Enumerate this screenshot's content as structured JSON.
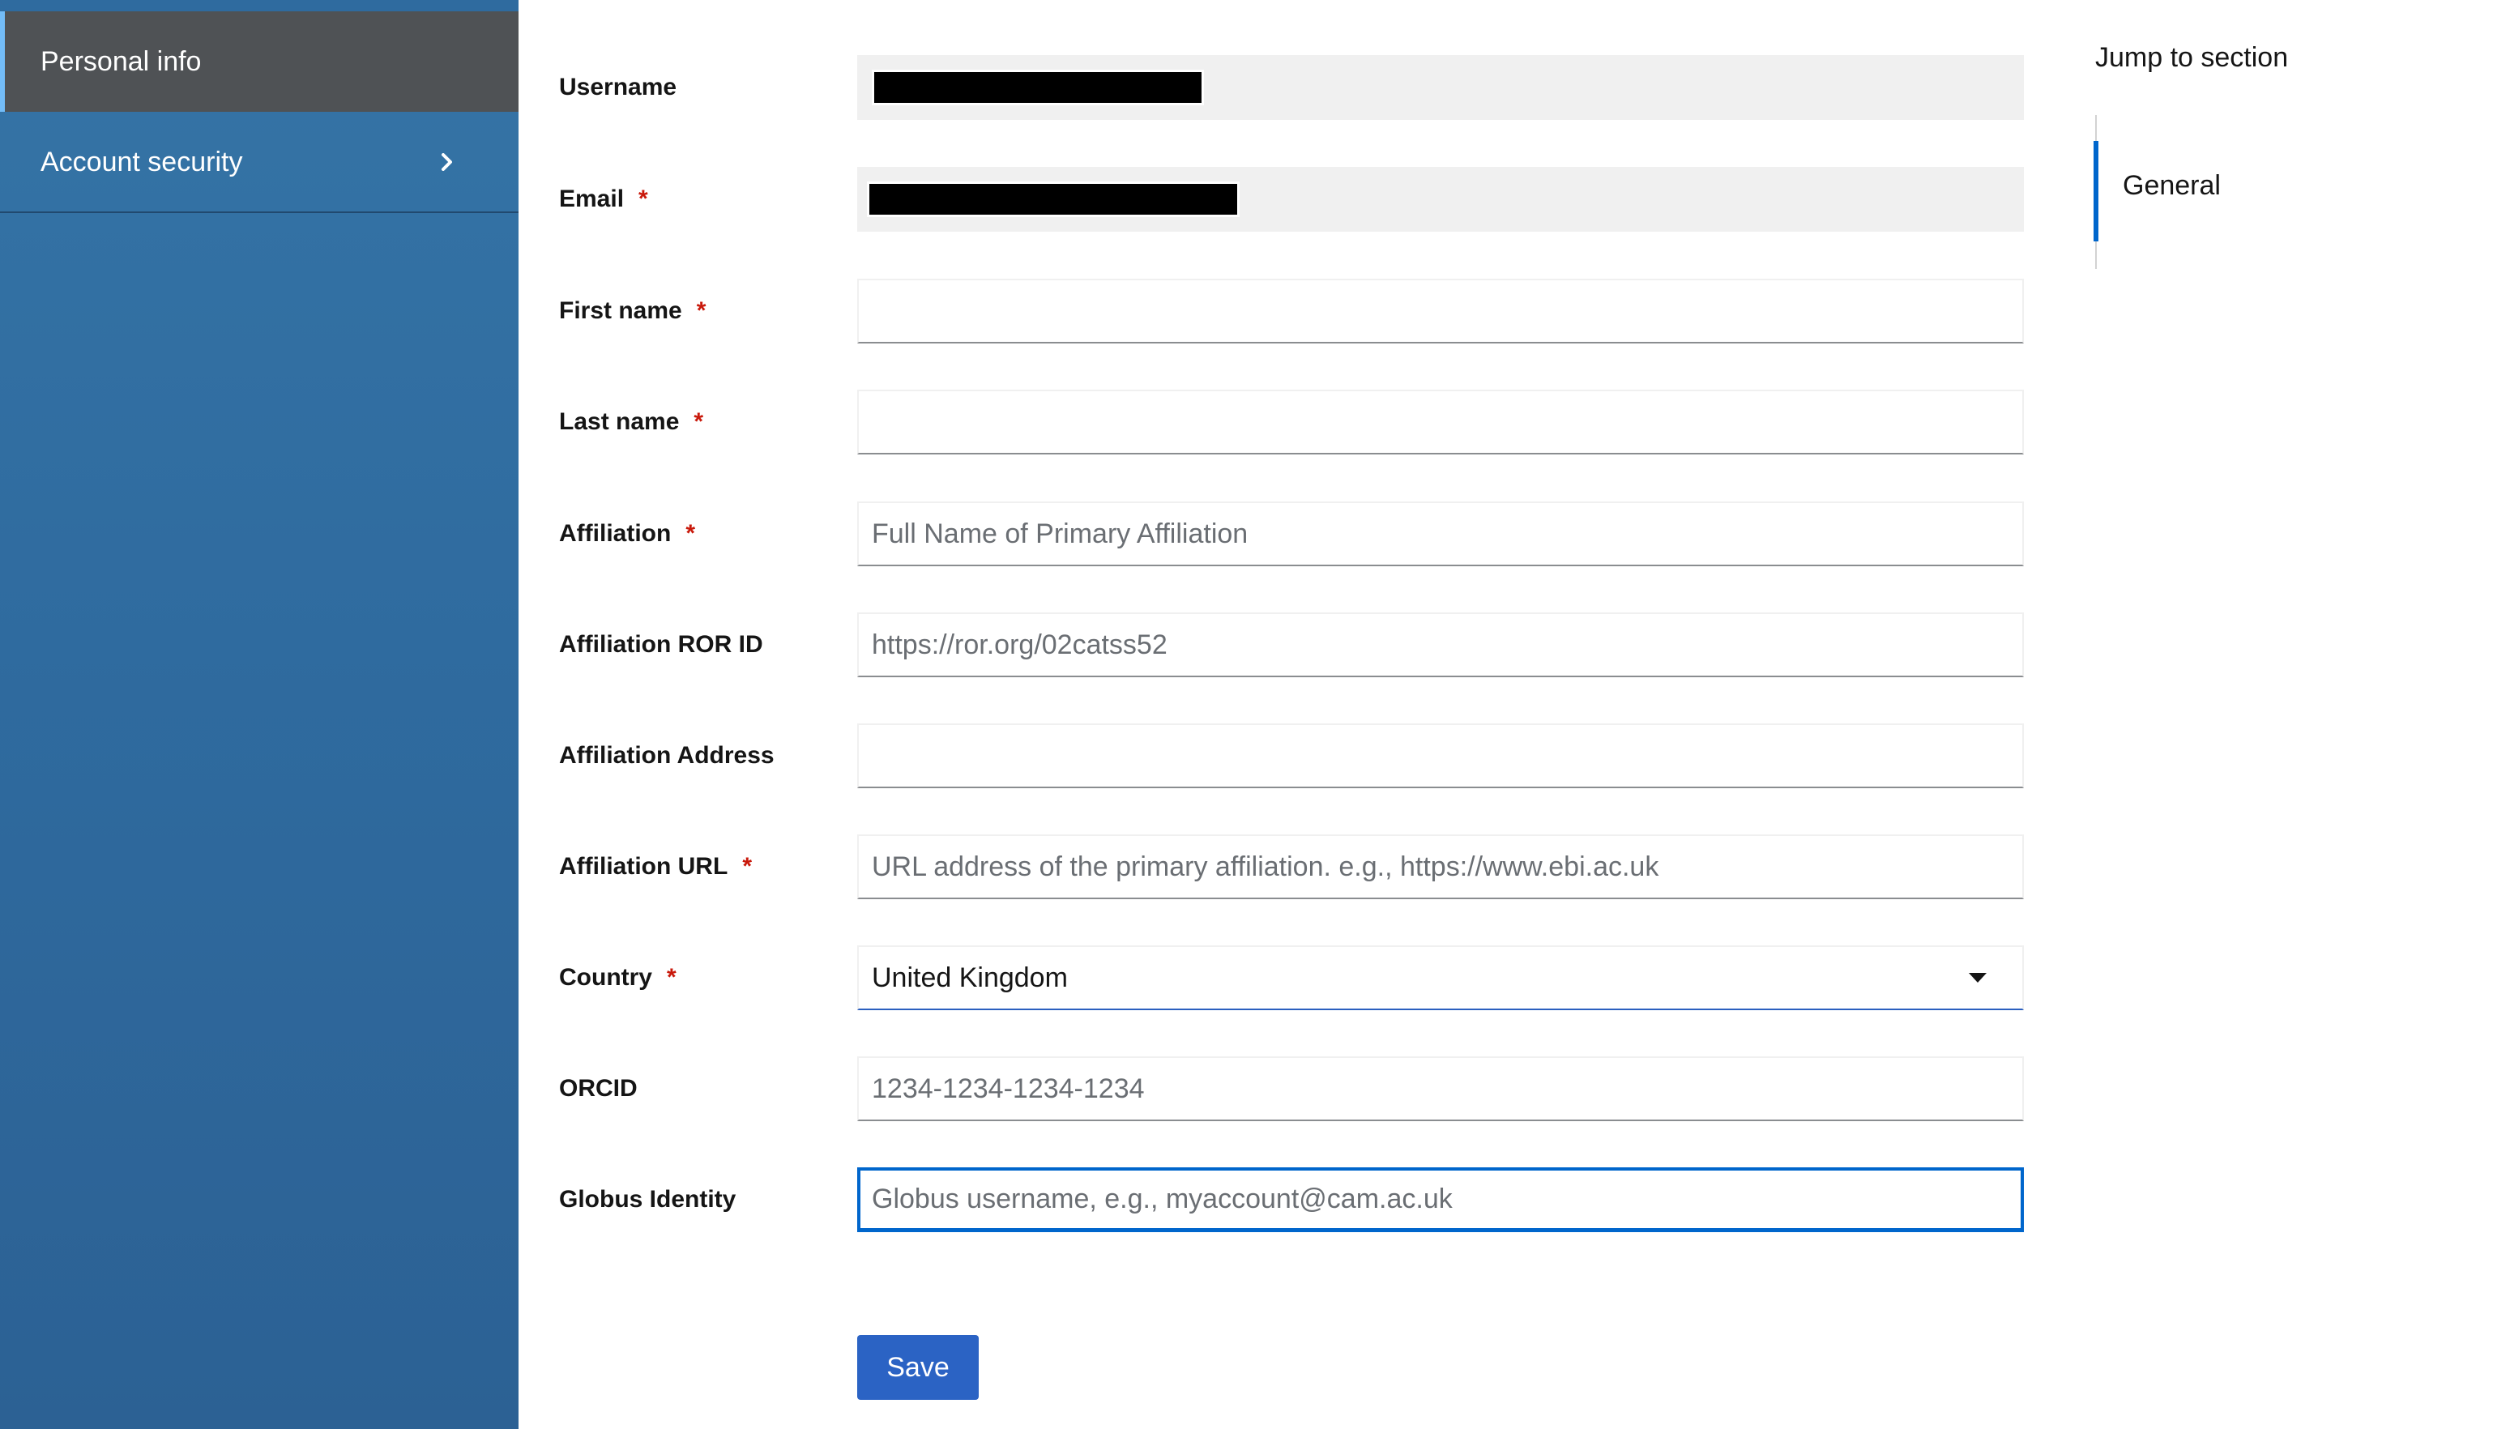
{
  "sidebar": {
    "items": [
      {
        "label": "Personal info"
      },
      {
        "label": "Account security"
      }
    ]
  },
  "form": {
    "fields": [
      {
        "label": "Username",
        "required": false,
        "value": "",
        "placeholder": ""
      },
      {
        "label": "Email",
        "required": true,
        "value": "",
        "placeholder": ""
      },
      {
        "label": "First name",
        "required": true,
        "value": "",
        "placeholder": ""
      },
      {
        "label": "Last name",
        "required": true,
        "value": "",
        "placeholder": ""
      },
      {
        "label": "Affiliation",
        "required": true,
        "value": "",
        "placeholder": "Full Name of Primary Affiliation"
      },
      {
        "label": "Affiliation ROR ID",
        "required": false,
        "value": "",
        "placeholder": "https://ror.org/02catss52"
      },
      {
        "label": "Affiliation Address",
        "required": false,
        "value": "",
        "placeholder": ""
      },
      {
        "label": "Affiliation URL",
        "required": true,
        "value": "",
        "placeholder": "URL address of the primary affiliation. e.g., https://www.ebi.ac.uk"
      },
      {
        "label": "Country",
        "required": true,
        "value": "United Kingdom",
        "placeholder": ""
      },
      {
        "label": "ORCID",
        "required": false,
        "value": "",
        "placeholder": "1234-1234-1234-1234"
      },
      {
        "label": "Globus Identity",
        "required": false,
        "value": "",
        "placeholder": "Globus username, e.g., myaccount@cam.ac.uk"
      }
    ],
    "required_marker": "*",
    "save_label": "Save"
  },
  "jump": {
    "title": "Jump to section",
    "links": [
      {
        "label": "General"
      }
    ]
  },
  "colors": {
    "sidebar_bg": "#2f6b9f",
    "sidebar_active_bg": "#4f5255",
    "required": "#c9190b",
    "primary": "#2b63c4",
    "focus": "#0066cc"
  }
}
